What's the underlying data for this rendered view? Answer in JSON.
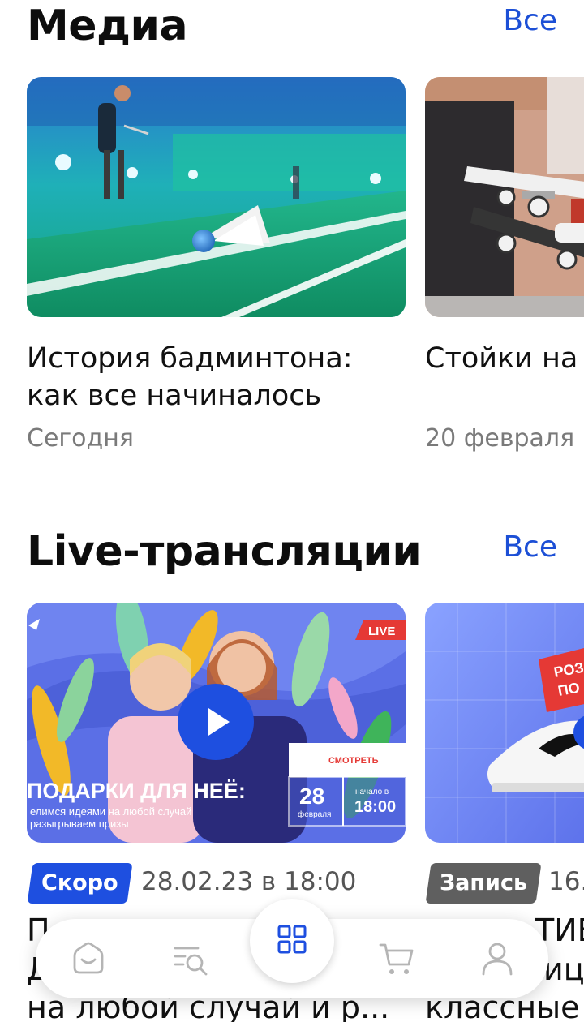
{
  "media": {
    "title": "Медиа",
    "see_all": "Все",
    "cards": [
      {
        "title_line1": "История бадминтона:",
        "title_line2": "как все начиналось",
        "date": "Сегодня"
      },
      {
        "title_line1": "Стойки на",
        "date": "20 февраля"
      }
    ]
  },
  "live": {
    "title": "Live-трансляции",
    "see_all": "Все",
    "cards": [
      {
        "badge": "Скоро",
        "badge_color": "#1e4fe0",
        "datetime": "28.02.23 в 18:00",
        "title_line1": "П",
        "title_line2": "Д",
        "title_line3": "на любой случай и р...",
        "banner": {
          "live_tag": "LIVE",
          "headline": "ПОДАРКИ ДЛЯ НЕЁ:",
          "sub1": "елимся идеями на любой случай",
          "sub2": "разыгрываем призы",
          "watch": "СМОТРЕТЬ",
          "day": "28",
          "month": "февраля",
          "start_label": "начало в",
          "start_time": "18:00"
        }
      },
      {
        "badge": "Запись",
        "badge_color": "#5f5f5f",
        "datetime": "16.",
        "title_line1": "ТИВ",
        "title_line2": "иц",
        "title_line3": "классные",
        "banner": {
          "tag_line1": "РОЗ",
          "tag_line2": "ПО"
        }
      }
    ]
  },
  "tabbar": {
    "items": [
      {
        "icon": "home-icon"
      },
      {
        "icon": "catalog-search-icon"
      },
      {
        "icon": "grid-icon",
        "active": true
      },
      {
        "icon": "cart-icon"
      },
      {
        "icon": "profile-icon"
      }
    ],
    "accent": "#1e4fe0"
  }
}
